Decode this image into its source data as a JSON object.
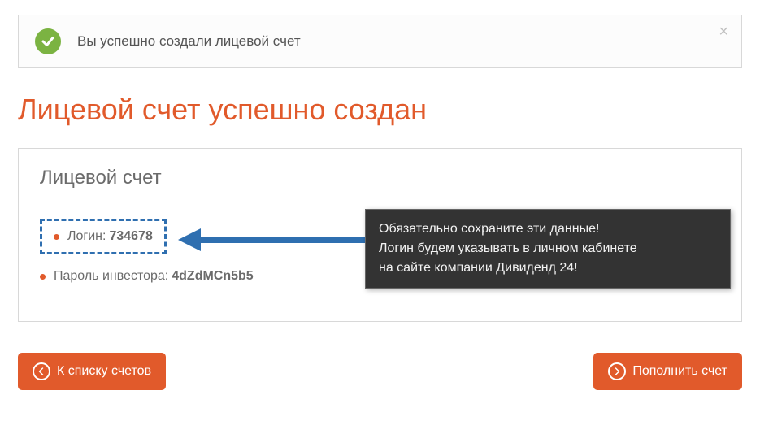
{
  "alert": {
    "message": "Вы успешно создали лицевой счет"
  },
  "page_title": "Лицевой счет успешно создан",
  "panel": {
    "title": "Лицевой счет",
    "login_label": "Логин:",
    "login_value": "734678",
    "password_label": "Пароль инвестора:",
    "password_value": "4dZdMCn5b5"
  },
  "tooltip": {
    "line1": "Обязательно сохраните эти данные!",
    "line2": "Логин будем указывать в личном кабинете",
    "line3": "на сайте компании Дивиденд 24!"
  },
  "buttons": {
    "back": "К списку счетов",
    "fund": "Пополнить счет"
  }
}
